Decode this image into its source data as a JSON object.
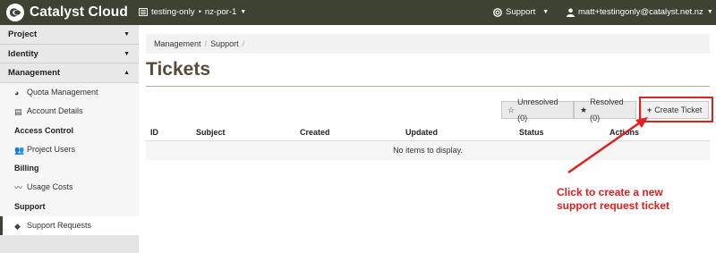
{
  "app": {
    "brand": "Catalyst Cloud"
  },
  "topbar": {
    "project": "testing-only",
    "region": "nz-por-1",
    "support": "Support",
    "user": "matt+testingonly@catalyst.net.nz"
  },
  "sidebar": {
    "sections": [
      "Project",
      "Identity",
      "Management"
    ],
    "groups": {
      "access_control": "Access Control",
      "billing": "Billing",
      "support": "Support"
    },
    "items": {
      "quota": "Quota Management",
      "account": "Account Details",
      "project_users": "Project Users",
      "usage_costs": "Usage Costs",
      "support_requests": "Support Requests"
    }
  },
  "breadcrumb": [
    "Management",
    "Support"
  ],
  "page": {
    "title": "Tickets"
  },
  "buttons": {
    "unresolved": "Unresolved (0)",
    "resolved": "Resolved (0)",
    "create": "Create Ticket"
  },
  "table": {
    "columns": [
      "ID",
      "Subject",
      "Created",
      "Updated",
      "Status",
      "Actions"
    ],
    "empty": "No items to display."
  },
  "annotation": {
    "line1": "Click to create a new",
    "line2": "support request ticket",
    "color": "#e02020"
  },
  "colors": {
    "topbar": "#3d4233",
    "title": "#5a4a3a"
  }
}
